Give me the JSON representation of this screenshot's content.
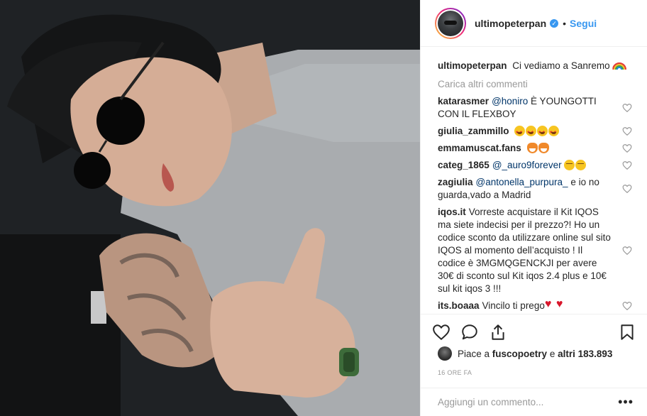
{
  "post": {
    "image_alt": "",
    "author": "ultimopeterpan",
    "follow_label": "Segui",
    "dot": "•"
  },
  "caption": {
    "username": "ultimopeterpan",
    "text": "Ci vediamo a Sanremo",
    "emoji": "rainbow"
  },
  "load_more": "Carica altri commenti",
  "comments": [
    {
      "username": "katarasmer",
      "mention": "@honiro",
      "text": " È YOUNGOTTI CON IL FLEXBOY"
    },
    {
      "username": "giulia_zammillo",
      "text": "",
      "emoji": [
        "star-eyes",
        "star-eyes",
        "star-eyes",
        "star-eyes"
      ]
    },
    {
      "username": "emmamuscat.fans",
      "text": "",
      "emoji": [
        "fox",
        "fox"
      ]
    },
    {
      "username": "categ_1865",
      "mention": "@_auro9forever",
      "text": " ",
      "emoji": [
        "relieved",
        "relieved"
      ]
    },
    {
      "username": "zagiulia",
      "mention": "@antonella_purpura_",
      "text": " e io no guarda,vado a Madrid"
    },
    {
      "username": "iqos.it",
      "text": "Vorreste acquistare il Kit IQOS ma siete indecisi per il prezzo?! Ho un codice sconto da utilizzare online sul sito IQOS al momento dell’acquisto ! Il codice è 3MGMQGENCKJI per avere 30€ di sconto sul Kit iqos 2.4 plus e 10€ sul kit iqos 3 !!!"
    },
    {
      "username": "its.boaaa",
      "text": "Vincilo ti prego",
      "emoji": [
        "heart-broken",
        "heart-broken"
      ]
    }
  ],
  "likes": {
    "prefix": "Piace a ",
    "user": "fuscopoetry",
    "middle": " e ",
    "others": "altri 183.893"
  },
  "time_ago": "16 ORE FA",
  "add_comment": {
    "placeholder": "Aggiungi un commento...",
    "more": "•••"
  },
  "icons": {
    "like": "heart-icon",
    "comment": "comment-icon",
    "share": "share-icon",
    "save": "bookmark-icon",
    "verified": "verified-badge-icon",
    "comment_like": "heart-outline-icon"
  },
  "colors": {
    "link": "#3897f0",
    "text": "#262626",
    "muted": "#999999",
    "border": "#efefef"
  }
}
